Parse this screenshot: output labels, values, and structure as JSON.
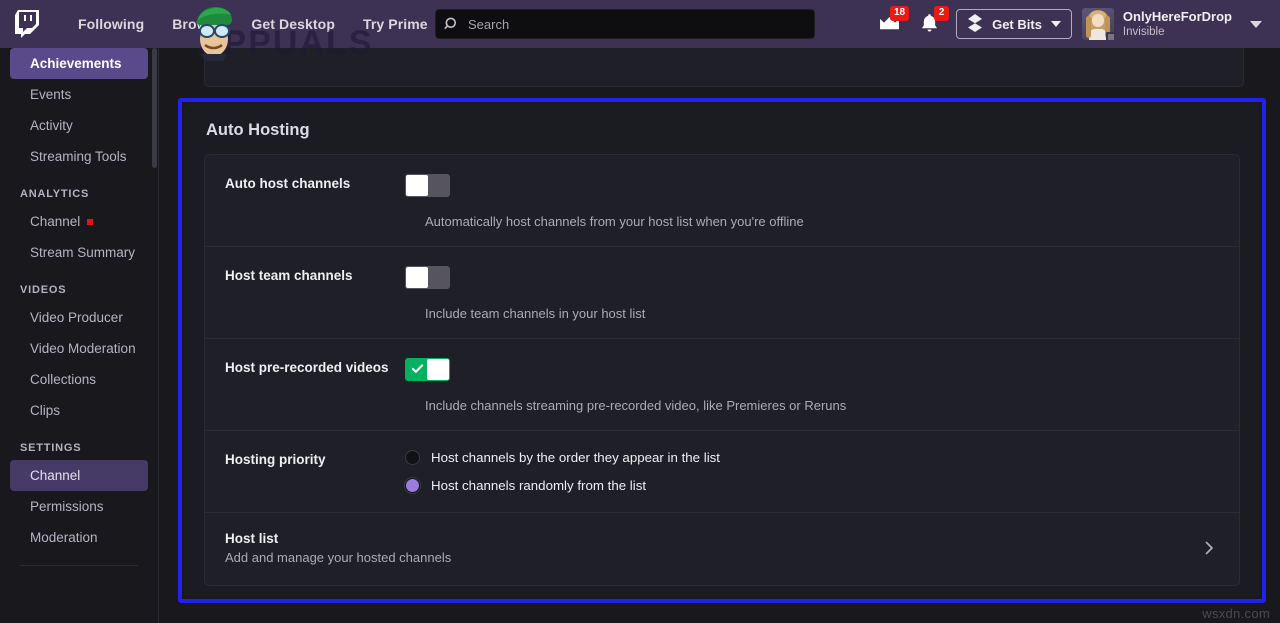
{
  "nav": {
    "logo_icon": "twitch-logo-icon",
    "links": [
      {
        "label": "Following"
      },
      {
        "label": "Browse"
      },
      {
        "label": "Get Desktop"
      },
      {
        "label": "Try Prime"
      }
    ],
    "more_label": "•••",
    "search": {
      "icon": "search-icon",
      "placeholder": "Search",
      "value": ""
    },
    "prime_crown": {
      "icon": "crown-icon",
      "badge": "18"
    },
    "notifications": {
      "icon": "bell-icon",
      "badge": "2"
    },
    "bits": {
      "icon": "bits-icon",
      "label": "Get Bits",
      "caret_icon": "chevron-down-icon"
    },
    "user": {
      "avatar_icon": "user-avatar",
      "name": "OnlyHereForDrop",
      "status": "Invisible",
      "status_dot_color": "#77747e",
      "caret_icon": "chevron-down-icon"
    }
  },
  "watermarks": {
    "header": "APPUALS",
    "footer": "wsxdn.com"
  },
  "sidebar": {
    "items": [
      {
        "label": "Achievements",
        "state": "active"
      },
      {
        "label": "Events",
        "state": "normal"
      },
      {
        "label": "Activity",
        "state": "normal"
      },
      {
        "label": "Streaming Tools",
        "state": "normal"
      }
    ],
    "sections": [
      {
        "heading": "ANALYTICS",
        "items": [
          {
            "label": "Channel",
            "state": "normal",
            "dot": true
          },
          {
            "label": "Stream Summary",
            "state": "normal",
            "dot": false
          }
        ]
      },
      {
        "heading": "VIDEOS",
        "items": [
          {
            "label": "Video Producer",
            "state": "normal",
            "dot": false
          },
          {
            "label": "Video Moderation",
            "state": "normal",
            "dot": false
          },
          {
            "label": "Collections",
            "state": "normal",
            "dot": false
          },
          {
            "label": "Clips",
            "state": "normal",
            "dot": false
          }
        ]
      },
      {
        "heading": "SETTINGS",
        "items": [
          {
            "label": "Channel",
            "state": "selected",
            "dot": false
          },
          {
            "label": "Permissions",
            "state": "normal",
            "dot": false
          },
          {
            "label": "Moderation",
            "state": "normal",
            "dot": false
          }
        ]
      }
    ]
  },
  "panel": {
    "title": "Auto Hosting",
    "highlight_color": "#2222ee",
    "rows": [
      {
        "label": "Auto host channels",
        "control": "toggle",
        "toggle_state": "off",
        "description": "Automatically host channels from your host list when you're offline"
      },
      {
        "label": "Host team channels",
        "control": "toggle",
        "toggle_state": "off",
        "description": "Include team channels in your host list"
      },
      {
        "label": "Host pre-recorded videos",
        "control": "toggle",
        "toggle_state": "on",
        "toggle_on_color": "#00b15f",
        "description": "Include channels streaming pre-recorded video, like Premieres or Reruns"
      }
    ],
    "priority": {
      "label": "Hosting priority",
      "options": [
        {
          "label": "Host channels by the order they appear in the list",
          "selected": false
        },
        {
          "label": "Host channels randomly from the list",
          "selected": true
        }
      ],
      "selected_color": "#9b7bdc"
    },
    "host_list": {
      "title": "Host list",
      "subtitle": "Add and manage your hosted channels",
      "chevron_icon": "chevron-right-icon"
    }
  }
}
